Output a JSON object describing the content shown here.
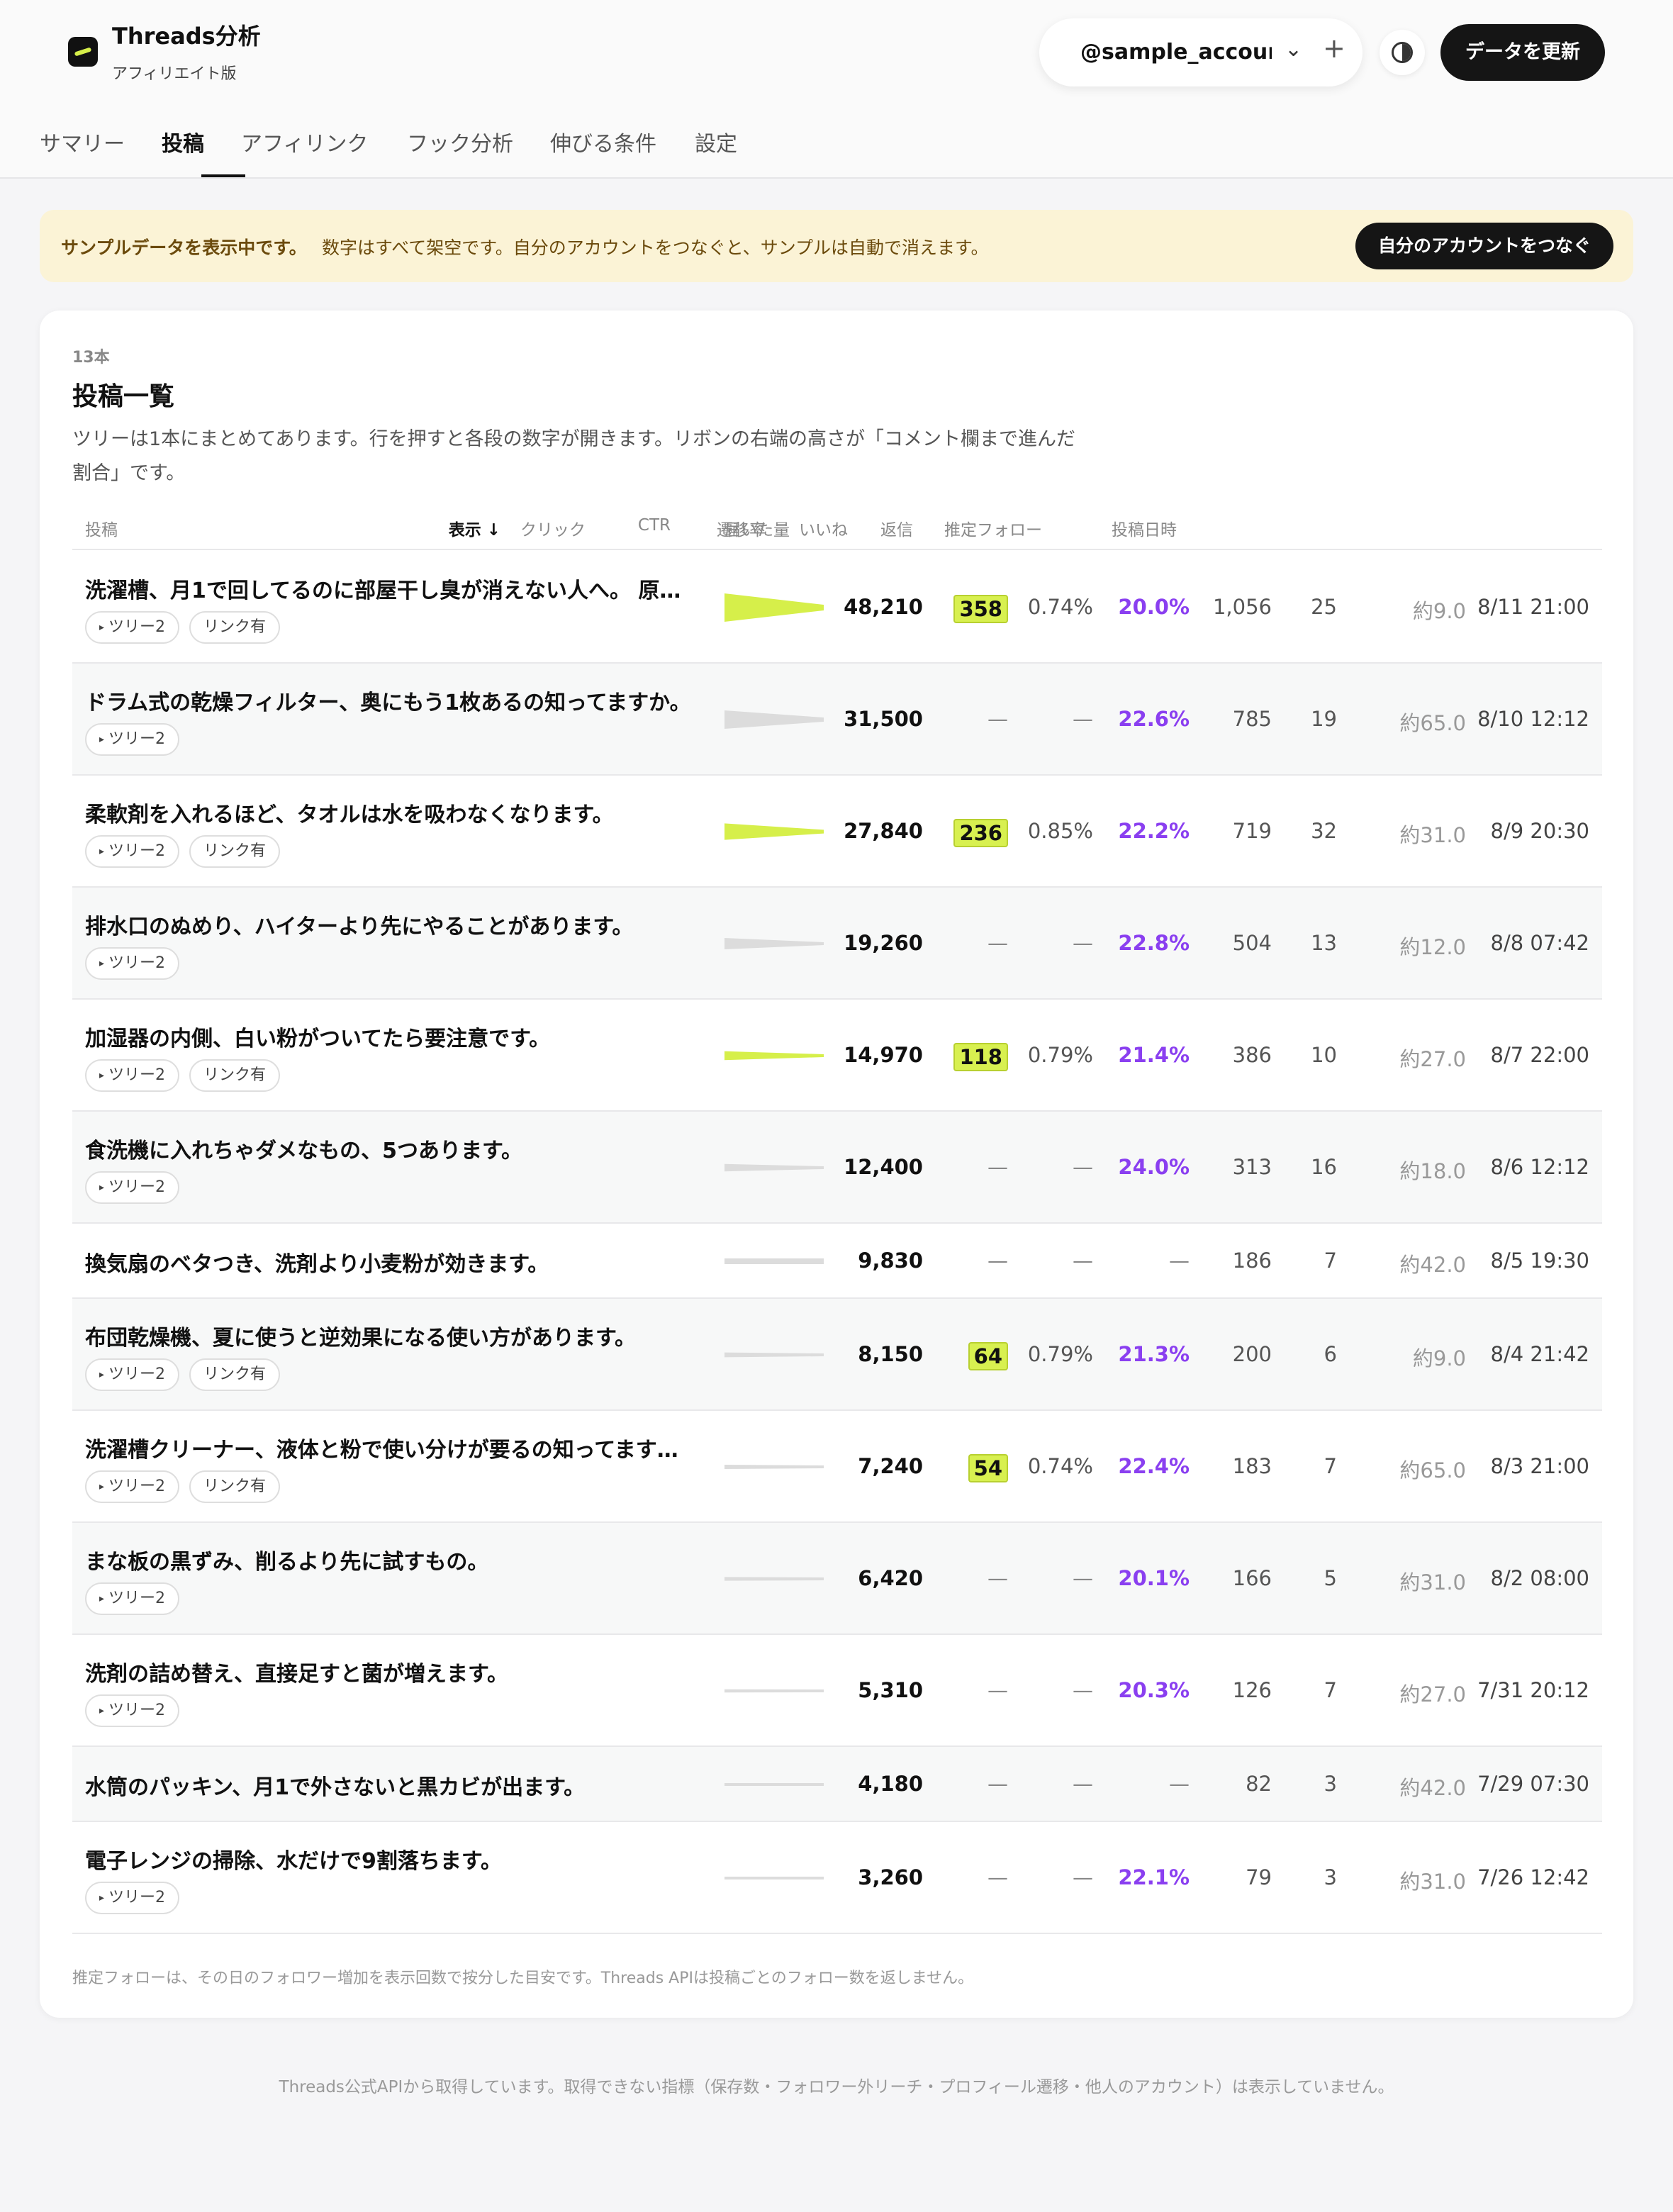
{
  "app": {
    "title": "Threads分析",
    "subtitle": "アフィリエイト版"
  },
  "account": {
    "name": "@sample_account"
  },
  "header": {
    "refresh_label": "データを更新"
  },
  "tabs": [
    "サマリー",
    "投稿",
    "アフィリンク",
    "フック分析",
    "伸びる条件",
    "設定"
  ],
  "banner": {
    "strong": "サンプルデータを表示中です。",
    "text": "数字はすべて架空です。自分のアカウントをつなぐと、サンプルは自動で消えます。",
    "button": "自分のアカウントをつなぐ"
  },
  "card": {
    "count": "13本",
    "title": "投稿一覧",
    "description": "ツリーは1本にまとめてあります。行を押すと各段の数字が開きます。リボンの右端の高さが「コメント欄まで進んだ割合」です。",
    "footnote": "推定フォローは、その日のフォロワー増加を表示回数で按分した目安です。Threads APIは投稿ごとのフォロー数を返しません。"
  },
  "columns": {
    "post": "投稿",
    "reach": "届いた量",
    "views": "表示 ↓",
    "clicks": "クリック",
    "ctr": "CTR",
    "transition": "遷移率",
    "likes": "いいね",
    "replies": "返信",
    "follows": "推定フォロー",
    "date": "投稿日時"
  },
  "rows": [
    {
      "title": "洗濯槽、月1で回してるのに部屋干し臭が消えない人へ。 原…",
      "tags": [
        "ツリー2",
        "リンク有"
      ],
      "views": "48,210",
      "clicks": "358",
      "ctr": "0.74%",
      "transition": "20.0%",
      "likes": "1,056",
      "replies": "25",
      "follows": "約9.0",
      "date": "8/11 21:00",
      "reach_ratio": 1.0,
      "reach_tail": 0.2,
      "accent": true
    },
    {
      "title": "ドラム式の乾燥フィルター、奥にもう1枚あるの知ってますか。",
      "tags": [
        "ツリー2"
      ],
      "views": "31,500",
      "clicks": "—",
      "ctr": "—",
      "transition": "22.6%",
      "likes": "785",
      "replies": "19",
      "follows": "約65.0",
      "date": "8/10 12:12",
      "reach_ratio": 0.65,
      "reach_tail": 0.226,
      "accent": false
    },
    {
      "title": "柔軟剤を入れるほど、タオルは水を吸わなくなります。",
      "tags": [
        "ツリー2",
        "リンク有"
      ],
      "views": "27,840",
      "clicks": "236",
      "ctr": "0.85%",
      "transition": "22.2%",
      "likes": "719",
      "replies": "32",
      "follows": "約31.0",
      "date": "8/9 20:30",
      "reach_ratio": 0.58,
      "reach_tail": 0.222,
      "accent": true
    },
    {
      "title": "排水口のぬめり、ハイターより先にやることがあります。",
      "tags": [
        "ツリー2"
      ],
      "views": "19,260",
      "clicks": "—",
      "ctr": "—",
      "transition": "22.8%",
      "likes": "504",
      "replies": "13",
      "follows": "約12.0",
      "date": "8/8 07:42",
      "reach_ratio": 0.4,
      "reach_tail": 0.228,
      "accent": false
    },
    {
      "title": "加湿器の内側、白い粉がついてたら要注意です。",
      "tags": [
        "ツリー2",
        "リンク有"
      ],
      "views": "14,970",
      "clicks": "118",
      "ctr": "0.79%",
      "transition": "21.4%",
      "likes": "386",
      "replies": "10",
      "follows": "約27.0",
      "date": "8/7 22:00",
      "reach_ratio": 0.31,
      "reach_tail": 0.214,
      "accent": true
    },
    {
      "title": "食洗機に入れちゃダメなもの、5つあります。",
      "tags": [
        "ツリー2"
      ],
      "views": "12,400",
      "clicks": "—",
      "ctr": "—",
      "transition": "24.0%",
      "likes": "313",
      "replies": "16",
      "follows": "約18.0",
      "date": "8/6 12:12",
      "reach_ratio": 0.26,
      "reach_tail": 0.24,
      "accent": false
    },
    {
      "title": "換気扇のベタつき、洗剤より小麦粉が効きます。",
      "tags": [],
      "views": "9,830",
      "clicks": "—",
      "ctr": "—",
      "transition": "—",
      "likes": "186",
      "replies": "7",
      "follows": "約42.0",
      "date": "8/5 19:30",
      "reach_ratio": 0.2,
      "reach_tail": 1.0,
      "accent": false
    },
    {
      "title": "布団乾燥機、夏に使うと逆効果になる使い方があります。",
      "tags": [
        "ツリー2",
        "リンク有"
      ],
      "views": "8,150",
      "clicks": "64",
      "ctr": "0.79%",
      "transition": "21.3%",
      "likes": "200",
      "replies": "6",
      "follows": "約9.0",
      "date": "8/4 21:42",
      "reach_ratio": 0.17,
      "reach_tail": 0.213,
      "accent": false
    },
    {
      "title": "洗濯槽クリーナー、液体と粉で使い分けが要るの知ってます…",
      "tags": [
        "ツリー2",
        "リンク有"
      ],
      "views": "7,240",
      "clicks": "54",
      "ctr": "0.74%",
      "transition": "22.4%",
      "likes": "183",
      "replies": "7",
      "follows": "約65.0",
      "date": "8/3 21:00",
      "reach_ratio": 0.15,
      "reach_tail": 0.224,
      "accent": false
    },
    {
      "title": "まな板の黒ずみ、削るより先に試すもの。",
      "tags": [
        "ツリー2"
      ],
      "views": "6,420",
      "clicks": "—",
      "ctr": "—",
      "transition": "20.1%",
      "likes": "166",
      "replies": "5",
      "follows": "約31.0",
      "date": "8/2 08:00",
      "reach_ratio": 0.13,
      "reach_tail": 0.201,
      "accent": false
    },
    {
      "title": "洗剤の詰め替え、直接足すと菌が増えます。",
      "tags": [
        "ツリー2"
      ],
      "views": "5,310",
      "clicks": "—",
      "ctr": "—",
      "transition": "20.3%",
      "likes": "126",
      "replies": "7",
      "follows": "約27.0",
      "date": "7/31 20:12",
      "reach_ratio": 0.11,
      "reach_tail": 0.203,
      "accent": false
    },
    {
      "title": "水筒のパッキン、月1で外さないと黒カビが出ます。",
      "tags": [],
      "views": "4,180",
      "clicks": "—",
      "ctr": "—",
      "transition": "—",
      "likes": "82",
      "replies": "3",
      "follows": "約42.0",
      "date": "7/29 07:30",
      "reach_ratio": 0.09,
      "reach_tail": 1.0,
      "accent": false
    },
    {
      "title": "電子レンジの掃除、水だけで9割落ちます。",
      "tags": [
        "ツリー2"
      ],
      "views": "3,260",
      "clicks": "—",
      "ctr": "—",
      "transition": "22.1%",
      "likes": "79",
      "replies": "3",
      "follows": "約31.0",
      "date": "7/26 12:42",
      "reach_ratio": 0.07,
      "reach_tail": 0.221,
      "accent": false
    }
  ],
  "colors": {
    "accent": "#d6ef4a",
    "neutral_ribbon": "#dcdcdc",
    "transition": "#8a3ff0",
    "banner_bg": "#fbf3d6"
  },
  "footer": "Threads公式APIから取得しています。取得できない指標（保存数・フォロワー外リーチ・プロフィール遷移・他人のアカウント）は表示していません。"
}
